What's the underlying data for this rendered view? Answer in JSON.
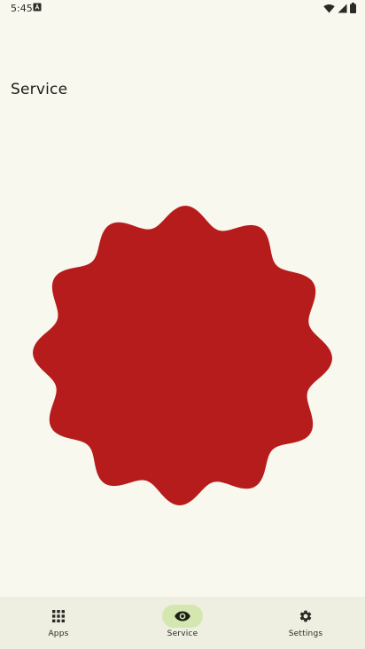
{
  "status_bar": {
    "time": "5:45",
    "notification_icon": "app-notification-icon",
    "wifi_icon": "wifi-icon",
    "signal_icon": "cell-signal-icon",
    "battery_icon": "battery-icon"
  },
  "page": {
    "title": "Service"
  },
  "service_indicator": {
    "icon": "scalloped-badge-shape",
    "color": "#b71c1c"
  },
  "bottom_nav": {
    "items": [
      {
        "label": "Apps",
        "icon": "grid-icon",
        "active": false
      },
      {
        "label": "Service",
        "icon": "eye-icon",
        "active": true
      },
      {
        "label": "Settings",
        "icon": "gear-icon",
        "active": false
      }
    ],
    "active_indicator_color": "#d4e7b0",
    "background_color": "#eeefe0"
  }
}
